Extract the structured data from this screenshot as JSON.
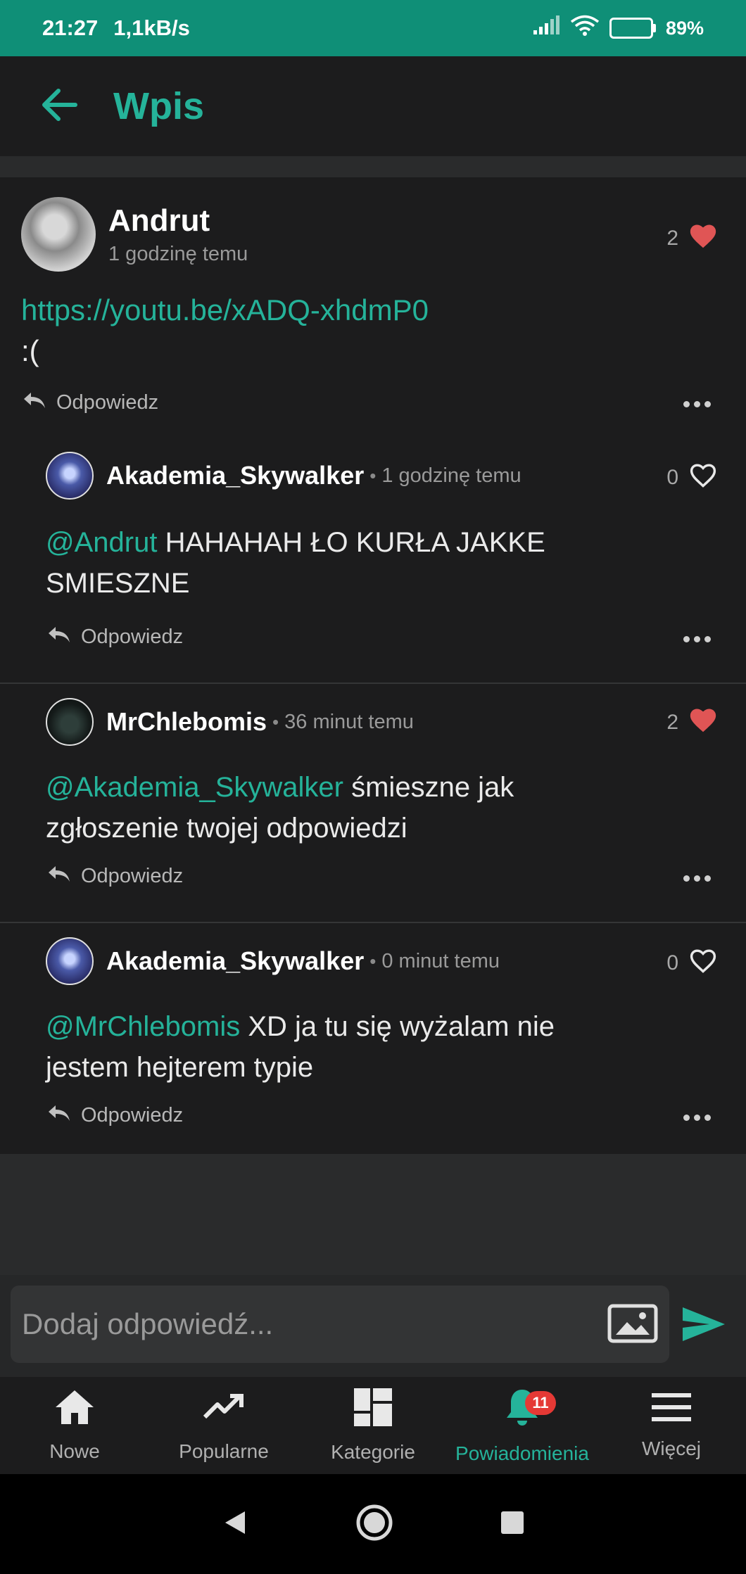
{
  "status": {
    "time": "21:27",
    "speed": "1,1kB/s",
    "battery": "89%"
  },
  "appbar": {
    "title": "Wpis"
  },
  "post": {
    "author": "Andrut",
    "time": "1 godzinę temu",
    "likes": "2",
    "link": "https://youtu.be/xADQ-xhdmP0",
    "text": ":(",
    "reply_label": "Odpowiedz"
  },
  "comments": [
    {
      "author": "Akademia_Skywalker",
      "time": "1 godzinę temu",
      "likes": "0",
      "liked": false,
      "mention": "@Andrut",
      "line1": " HAHAHAH ŁO KURŁA JAKKE",
      "line2": "SMIESZNE",
      "reply_label": "Odpowiedz"
    },
    {
      "author": "MrChlebomis",
      "time": "36 minut temu",
      "likes": "2",
      "liked": true,
      "mention": "@Akademia_Skywalker",
      "line1": " śmieszne jak",
      "line2": "zgłoszenie twojej odpowiedzi",
      "reply_label": "Odpowiedz"
    },
    {
      "author": "Akademia_Skywalker",
      "time": "0 minut temu",
      "likes": "0",
      "liked": false,
      "mention": "@MrChlebomis",
      "line1": " XD ja tu się wyżalam nie",
      "line2": "jestem hejterem typie",
      "reply_label": "Odpowiedz"
    }
  ],
  "composer": {
    "placeholder": "Dodaj odpowiedź..."
  },
  "nav": {
    "items": [
      {
        "label": "Nowe",
        "icon": "home-icon"
      },
      {
        "label": "Popularne",
        "icon": "trending-icon"
      },
      {
        "label": "Kategorie",
        "icon": "dashboard-icon"
      },
      {
        "label": "Powiadomienia",
        "icon": "bell-icon",
        "badge": "11"
      },
      {
        "label": "Więcej",
        "icon": "menu-icon"
      }
    ]
  },
  "colors": {
    "accent": "#25b39a",
    "heart": "#e05555",
    "statusbar": "#0f8f77",
    "badge": "#e53935"
  }
}
